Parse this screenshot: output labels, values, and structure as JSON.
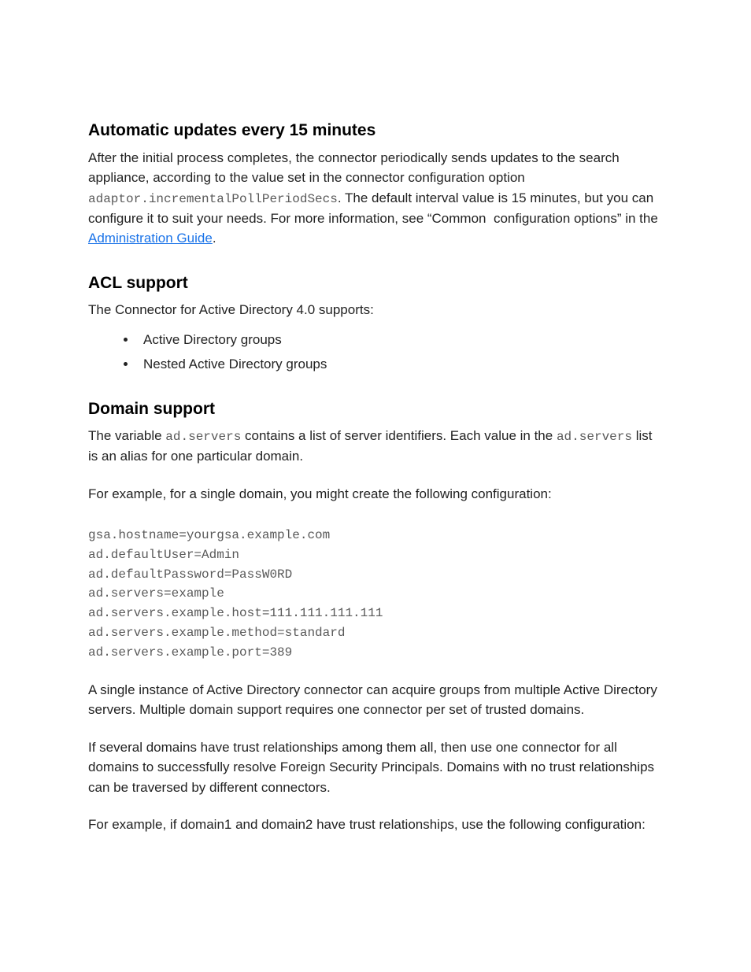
{
  "sections": {
    "automatic_updates": {
      "heading": "Automatic updates every 15 minutes",
      "para1_part1": "After the initial process completes, the connector periodically sends updates to the search appliance, according to the value set in the connector configuration option ",
      "para1_code": "adaptor.incrementalPollPeriodSecs",
      "para1_part2": ". The default interval value is 15 minutes, but you can configure it to suit your needs. For more information, see “Common  configuration options” in the ",
      "para1_link": "Administration Guide",
      "para1_part3": "."
    },
    "acl_support": {
      "heading": "ACL support",
      "intro": "The Connector for Active Directory 4.0 supports:",
      "items": [
        "Active Directory groups",
        "Nested Active Directory groups"
      ]
    },
    "domain_support": {
      "heading": "Domain support",
      "para1_part1": "The variable ",
      "para1_code1": "ad.servers",
      "para1_part2": " contains a list of server identifiers. Each value in the ",
      "para1_code2": "ad.servers",
      "para1_part3": " list is an alias for one particular domain.",
      "para2": "For example, for a single domain, you might create the following configuration:",
      "code_block": "gsa.hostname=yourgsa.example.com\nad.defaultUser=Admin\nad.defaultPassword=PassW0RD\nad.servers=example\nad.servers.example.host=111.111.111.111\nad.servers.example.method=standard\nad.servers.example.port=389",
      "para3": "A single instance of Active Directory connector can acquire groups from multiple Active Directory servers. Multiple domain support requires one connector per set of trusted domains.",
      "para4": "If several domains have trust relationships among them all, then use one connector for all domains to successfully resolve Foreign Security Principals. Domains with no trust relationships can be traversed by different connectors.",
      "para5": "For example, if domain1 and domain2 have trust relationships, use the following configuration:"
    }
  }
}
